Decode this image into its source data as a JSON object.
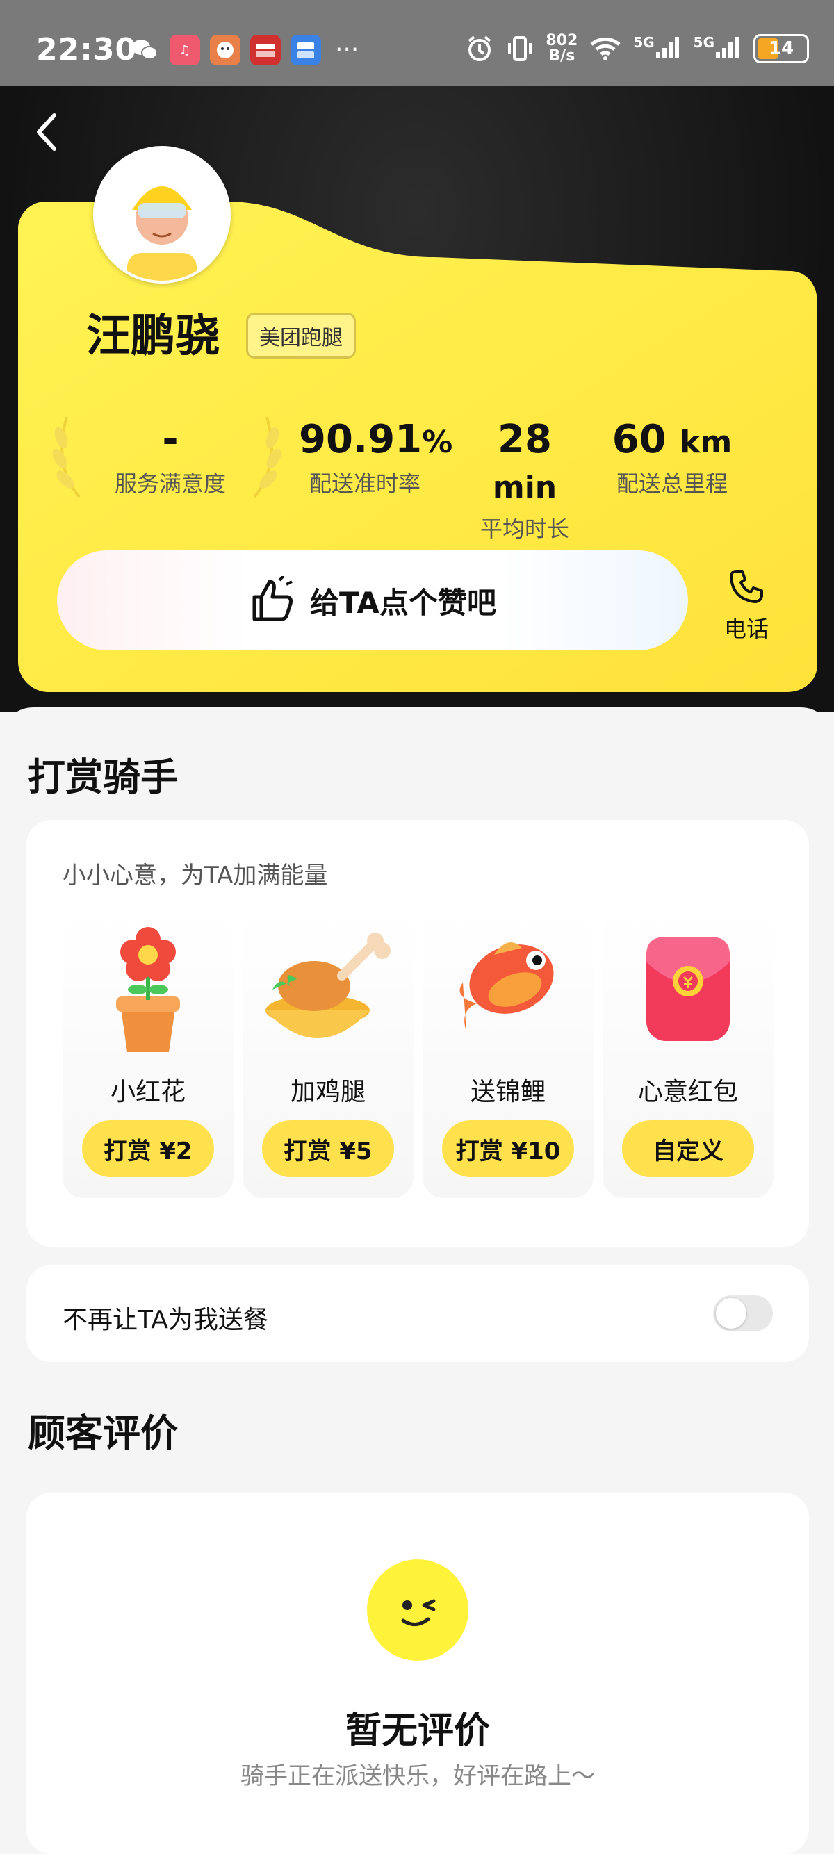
{
  "status_bar": {
    "time": "22:30",
    "apps": [
      {
        "icon": "wechat-icon",
        "label": "",
        "color": "#7a7a7a"
      },
      {
        "icon": "music-icon",
        "label": "♫",
        "color": "#f05a6e"
      },
      {
        "icon": "game-icon",
        "label": "",
        "color": "#e06a3a"
      },
      {
        "icon": "pay-icon",
        "label": "",
        "color": "#d0302e"
      },
      {
        "icon": "live-icon",
        "label": "",
        "color": "#3b82e6"
      }
    ],
    "net_speed_value": "802",
    "net_speed_unit": "B/s",
    "network_1": "5G",
    "network_2": "5G",
    "battery": "14"
  },
  "rider": {
    "name": "汪鹏骁",
    "tag": "美团跑腿"
  },
  "stats": [
    {
      "value": "-",
      "unit": "",
      "label": "服务满意度"
    },
    {
      "value": "90.91",
      "unit": "%",
      "label": "配送准时率"
    },
    {
      "value": "28",
      "unit": "min",
      "label": "平均时长"
    },
    {
      "value": "60",
      "unit": "km",
      "label": "配送总里程"
    }
  ],
  "like_button": "给TA点个赞吧",
  "phone_label": "电话",
  "tip_section": {
    "title": "打赏骑手",
    "subtitle": "小小心意，为TA加满能量",
    "gifts": [
      {
        "name": "小红花",
        "button": "打赏 ¥2",
        "icon": "flower-icon"
      },
      {
        "name": "加鸡腿",
        "button": "打赏 ¥5",
        "icon": "chicken-leg-icon"
      },
      {
        "name": "送锦鲤",
        "button": "打赏 ¥10",
        "icon": "koi-fish-icon"
      },
      {
        "name": "心意红包",
        "button": "自定义",
        "icon": "red-envelope-icon"
      }
    ]
  },
  "no_delivery_toggle": {
    "label": "不再让TA为我送餐",
    "on": false
  },
  "reviews": {
    "title": "顾客评价",
    "empty_title": "暂无评价",
    "empty_subtitle": "骑手正在派送快乐，好评在路上～"
  },
  "colors": {
    "accent": "#ffe14d",
    "card_yellow": "#fff04a",
    "background": "#f5f5f5"
  }
}
